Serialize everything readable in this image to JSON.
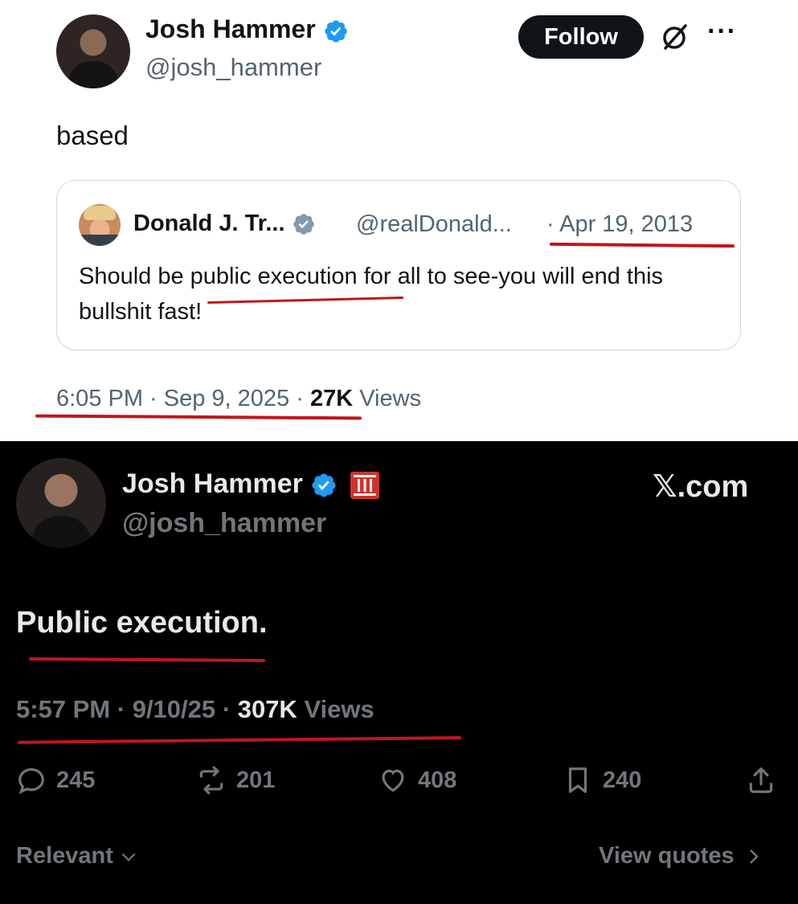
{
  "top_tweet": {
    "author_name": "Josh Hammer",
    "handle": "@josh_hammer",
    "follow_label": "Follow",
    "more_label": "···",
    "body": "based",
    "quoted": {
      "author_name": "Donald J. Tr...",
      "handle": "@realDonald...",
      "date": "· Apr 19, 2013",
      "text": "Should be public execution for all to see-you will end this bullshit fast!"
    },
    "time": "6:05 PM · Sep 9, 2025 ·",
    "views_count": "27K",
    "views_label": "Views"
  },
  "bottom_tweet": {
    "author_name": "Josh Hammer",
    "handle": "@josh_hammer",
    "brand": "𝕏.com",
    "body": "Public execution.",
    "time": "5:57 PM · 9/10/25 ·",
    "views_count": "307K",
    "views_label": "Views",
    "actions": {
      "replies": "245",
      "reposts": "201",
      "likes": "408",
      "bookmarks": "240"
    },
    "sort_label": "Relevant",
    "view_quotes_label": "View quotes"
  },
  "colors": {
    "verified_blue": "#1d9bf0",
    "annotation_red": "#c0161b",
    "light_secondary": "#536471",
    "dark_secondary": "#71767b",
    "dark_primary": "#e7e9ea"
  },
  "icons": [
    "verified-badge-icon",
    "grok-icon",
    "more-icon",
    "flag-icon",
    "reply-icon",
    "repost-icon",
    "like-icon",
    "bookmark-icon",
    "share-icon",
    "chevron-down-icon",
    "chevron-right-icon"
  ]
}
